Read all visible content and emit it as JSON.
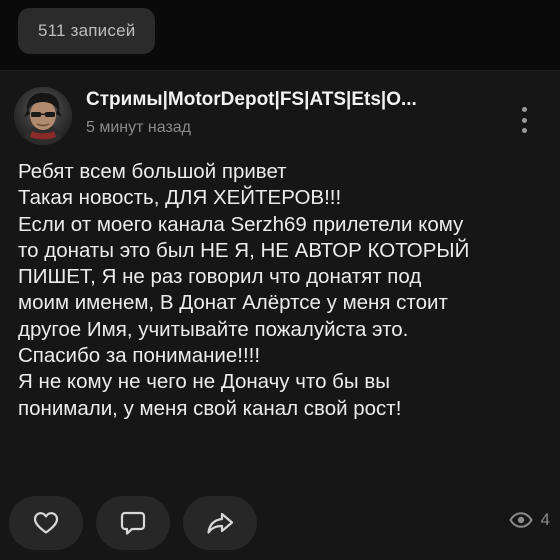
{
  "header": {
    "records_count": "511 записей"
  },
  "post": {
    "author": "Стримы|MotorDepot|FS|ATS|Ets|O...",
    "time": "5 минут назад",
    "text_lines": [
      "Ребят всем большой привет",
      "Такая новость, ДЛЯ ХЕЙТЕРОВ!!!",
      "Если от моего канала Serzh69 прилетели кому",
      "то донаты это был НЕ Я, НЕ АВТОР КОТОРЫЙ",
      "ПИШЕТ, Я не раз говорил что донатят под",
      "моим именем, В Донат Алёртсе у меня стоит",
      "другое Имя, учитывайте пожалуйста это.",
      "Спасибо за понимание!!!!",
      "Я не кому не чего не Доначу что бы вы",
      "понимали, у меня свой канал свой рост!"
    ],
    "actions": {
      "like_icon": "heart-icon",
      "comment_icon": "comment-icon",
      "share_icon": "share-icon"
    },
    "views": "4"
  },
  "colors": {
    "background": "#0a0a0a",
    "post_background": "#161616",
    "pill_background": "#2b2b2b",
    "button_background": "#272727",
    "text_primary": "#ececec",
    "text_secondary": "#8a8a8a"
  }
}
